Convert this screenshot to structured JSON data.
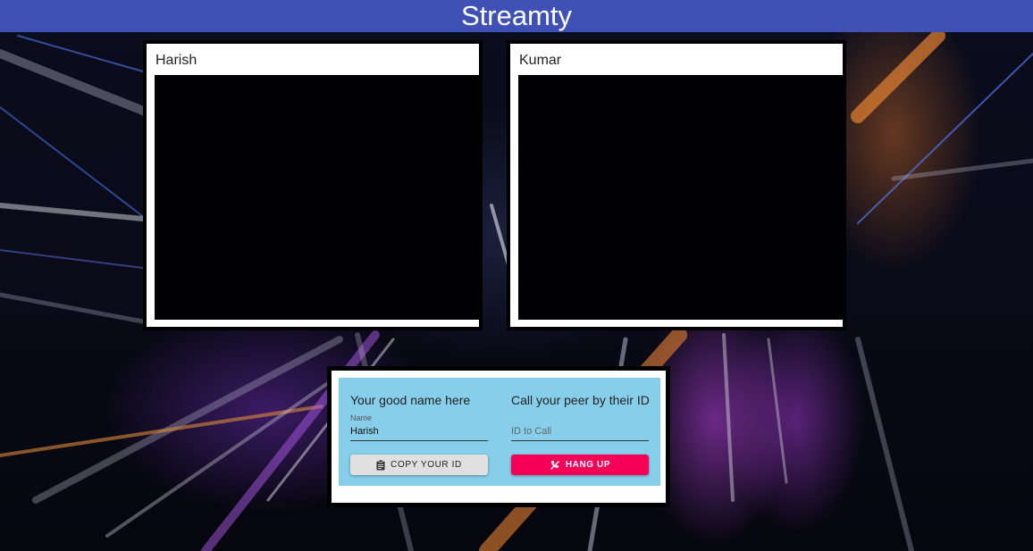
{
  "app": {
    "title": "Streamty"
  },
  "videos": [
    {
      "name": "Harish"
    },
    {
      "name": "Kumar"
    }
  ],
  "options": {
    "left": {
      "heading": "Your good name here",
      "name_label": "Name",
      "name_value": "Harish",
      "copy_button": "Copy Your ID",
      "copy_icon": "clipboard-icon"
    },
    "right": {
      "heading": "Call your peer by their ID",
      "id_placeholder": "ID to Call",
      "hangup_button": "Hang Up",
      "hangup_icon": "phone-disabled-icon"
    }
  },
  "colors": {
    "header": "#3f51b5",
    "panel": "#87ceeb",
    "hangup": "#f50057",
    "copy": "#e0e0e0"
  }
}
